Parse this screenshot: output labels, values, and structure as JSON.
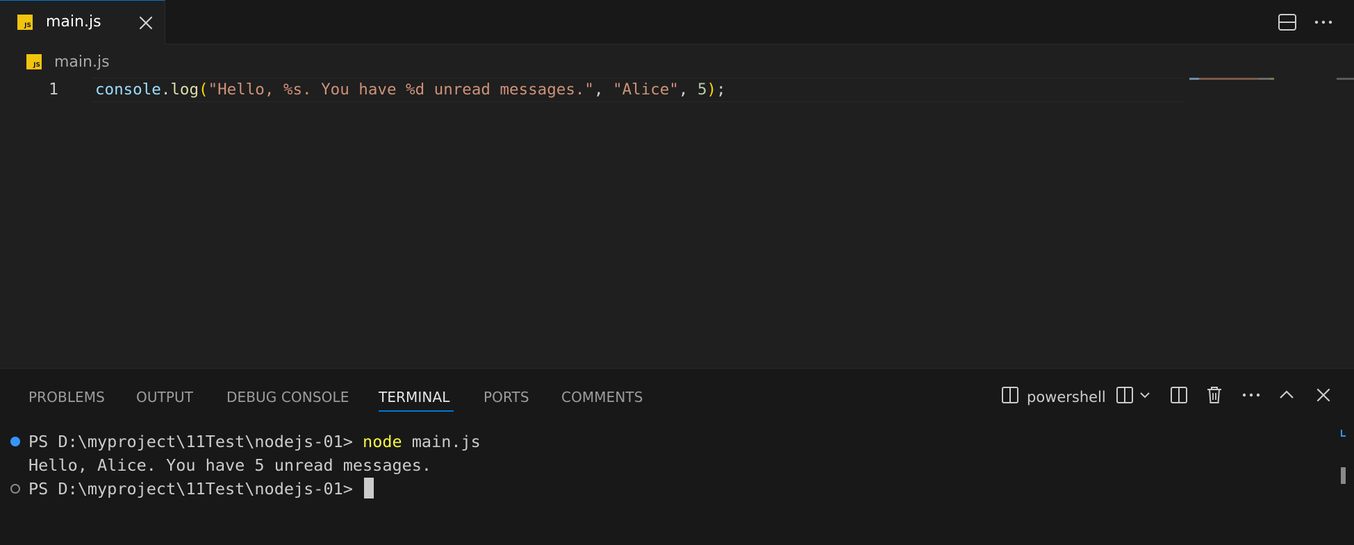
{
  "tab": {
    "label": "main.js",
    "icon_text": "JS",
    "icon": "close-icon"
  },
  "editor_actions": {
    "split_icon": "split-editor-icon",
    "more_icon": "more-actions-icon"
  },
  "breadcrumb": {
    "icon_text": "JS",
    "file": "main.js"
  },
  "editor": {
    "line_number": "1",
    "code": {
      "obj": "console",
      "dot": ".",
      "method": "log",
      "open_paren": "(",
      "string1": "\"Hello, %s. You have %d unread messages.\"",
      "comma1": ", ",
      "string2": "\"Alice\"",
      "comma2": ", ",
      "number": "5",
      "close_paren": ")",
      "semicolon": ";"
    }
  },
  "panel": {
    "tabs": [
      "PROBLEMS",
      "OUTPUT",
      "DEBUG CONSOLE",
      "TERMINAL",
      "PORTS",
      "COMMENTS"
    ],
    "active_tab": "TERMINAL",
    "terminal_name": "powershell",
    "actions": [
      "terminal-icon",
      "split-terminal-icon",
      "chevron-down-icon",
      "split-panel-icon",
      "trash-icon",
      "more-actions-icon",
      "maximize-panel-icon",
      "close-panel-icon"
    ]
  },
  "terminal": {
    "line1_prompt": "PS D:\\myproject\\11Test\\nodejs-01> ",
    "line1_cmd": "node",
    "line1_args": " main.js",
    "line2": "Hello, Alice. You have 5 unread messages.",
    "line3_prompt": "PS D:\\myproject\\11Test\\nodejs-01> "
  },
  "colors": {
    "accent": "#0078d4",
    "js_badge": "#f1c40f",
    "string": "#ce9178",
    "variable": "#9cdcfe",
    "function": "#dcdcaa",
    "number": "#b5cea8",
    "bracket": "#ffd700",
    "terminal_command": "#f5f543"
  }
}
